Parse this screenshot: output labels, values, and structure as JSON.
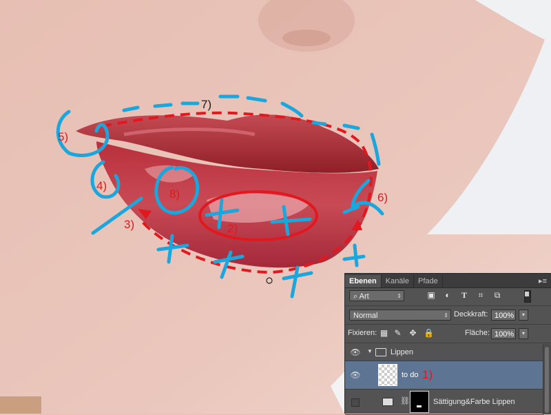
{
  "canvas": {
    "annotations": [
      "7)",
      "5)",
      "4)",
      "8)",
      "3)",
      "2)",
      "6)",
      "1)"
    ],
    "colors": {
      "marker_blue": "#1aa7dd",
      "marker_red": "#e3181f",
      "lip": "#b8353e",
      "skin": "#e9c2b8"
    }
  },
  "layers_panel": {
    "tabs": [
      "Ebenen",
      "Kanäle",
      "Pfade"
    ],
    "active_tab": "Ebenen",
    "panel_menu_icon": "panel-menu-icon",
    "filter": {
      "kind_label": "Art",
      "icons": [
        "image-filter-icon",
        "adjustment-filter-icon",
        "type-filter-icon",
        "shape-filter-icon",
        "smartobject-filter-icon"
      ]
    },
    "blend_mode": "Normal",
    "opacity_label": "Deckkraft:",
    "opacity_value": "100%",
    "lock_label": "Fixieren:",
    "fill_label": "Fläche:",
    "fill_value": "100%",
    "layers": [
      {
        "name": "Lippen",
        "type": "group",
        "visible": true
      },
      {
        "name": "to do",
        "type": "pixel",
        "visible": true,
        "selected": true,
        "note": "1)"
      },
      {
        "name": "Sättigung&Farbe Lippen",
        "type": "adjustment",
        "visible": false
      }
    ]
  }
}
